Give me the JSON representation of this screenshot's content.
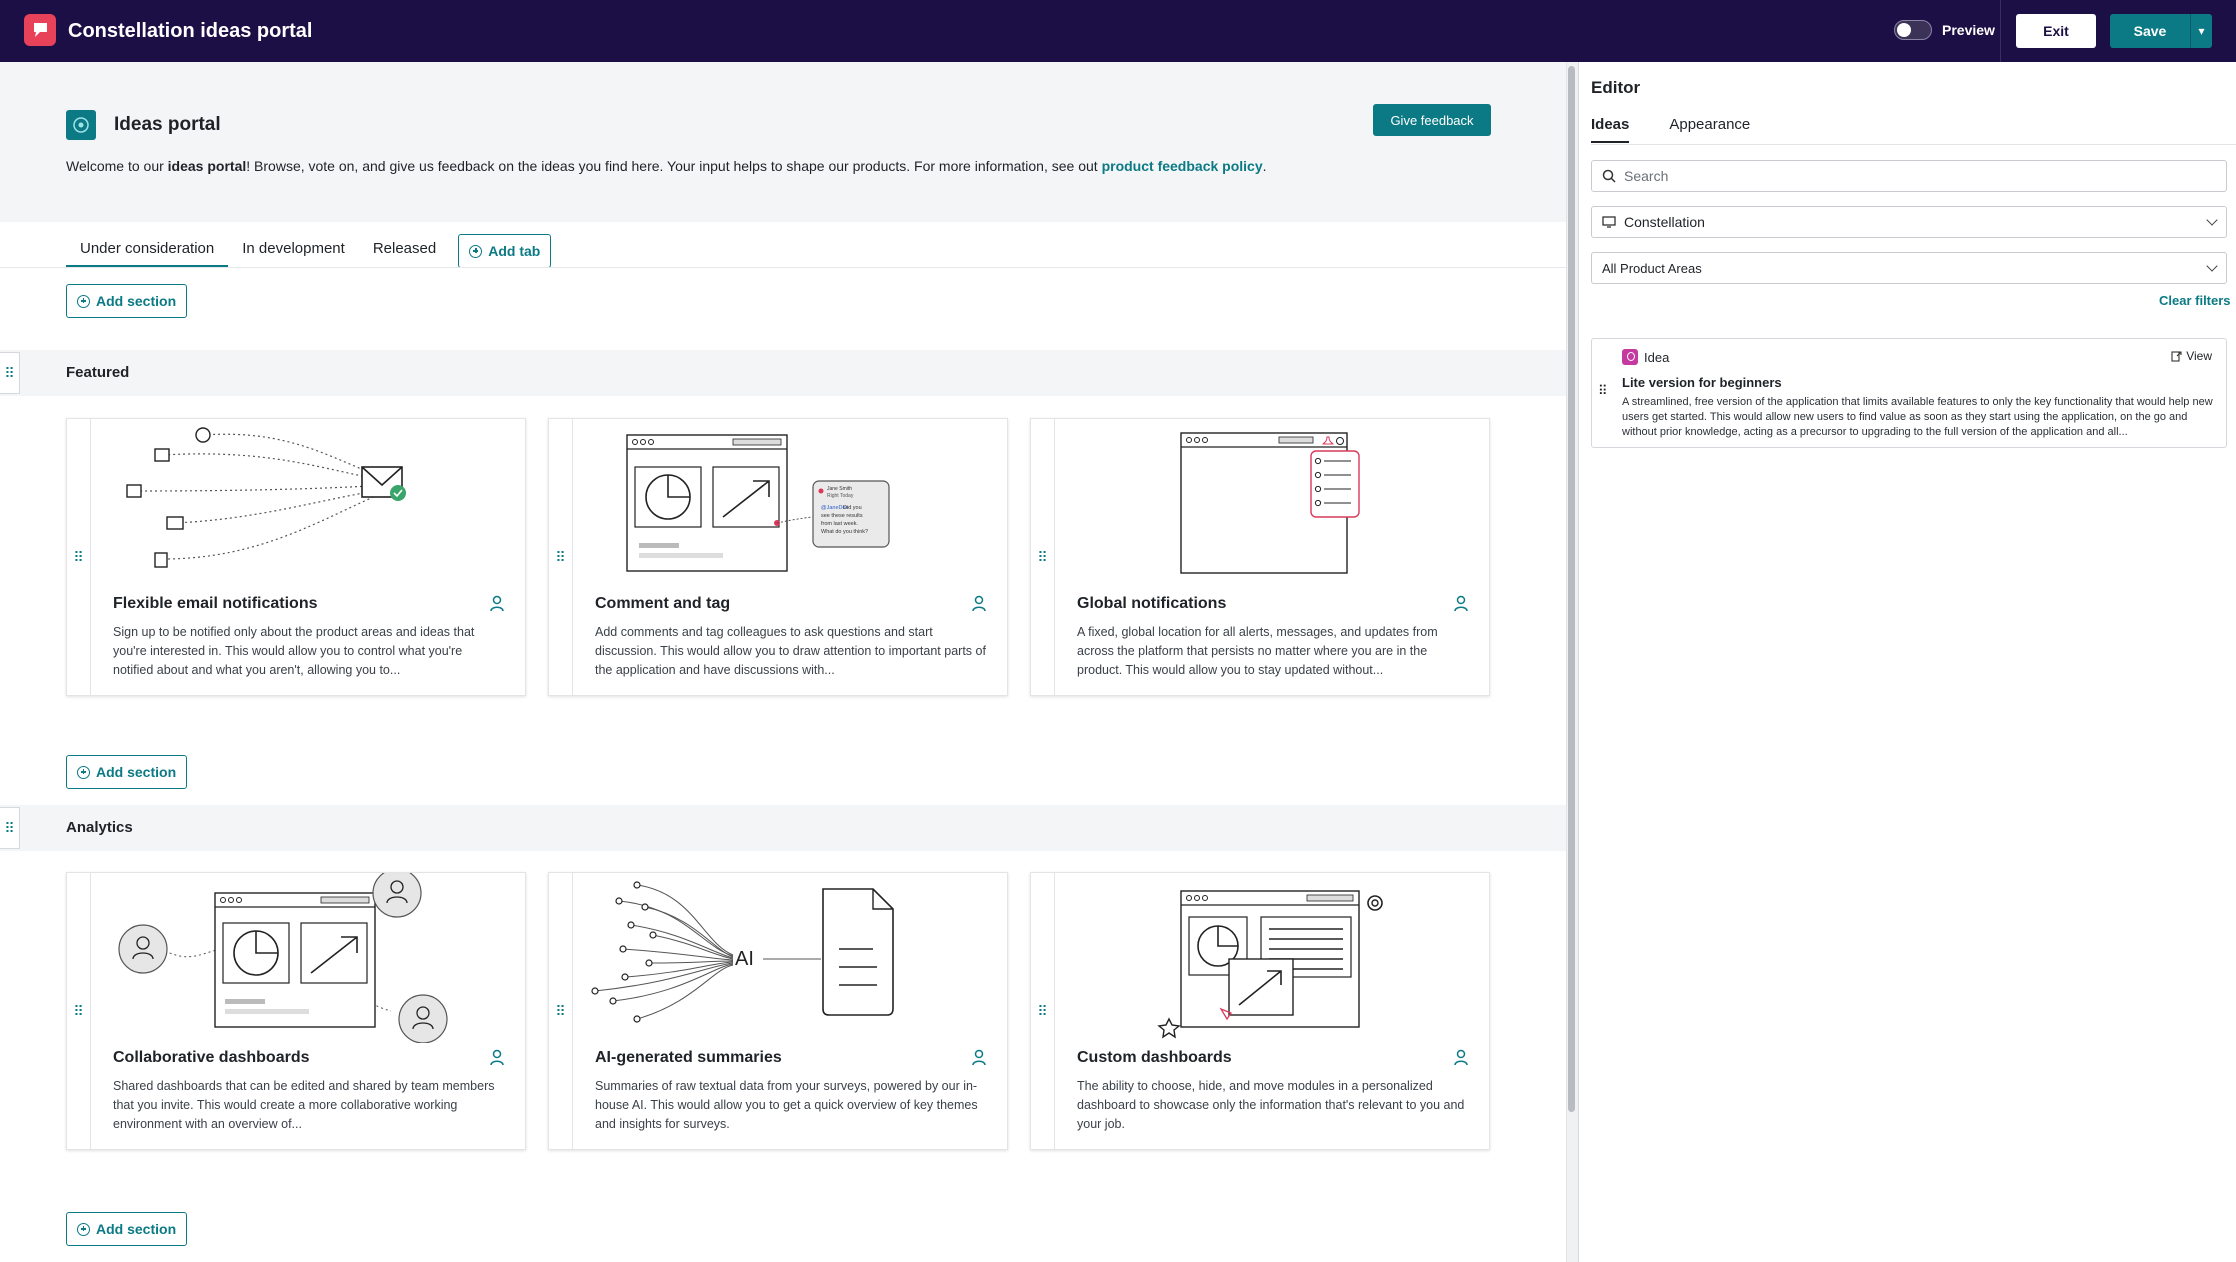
{
  "app": {
    "title": "Constellation ideas portal"
  },
  "header": {
    "preview_label": "Preview",
    "exit_label": "Exit",
    "save_label": "Save"
  },
  "portal": {
    "title": "Ideas portal",
    "feedback_label": "Give feedback",
    "welcome_prefix": "Welcome to our ",
    "welcome_bold": "ideas portal",
    "welcome_middle": "! Browse, vote on, and give us feedback on the ideas you find here. Your input helps to shape our products. For more information, see out ",
    "welcome_link": "product feedback policy",
    "welcome_suffix": "."
  },
  "tabs": [
    "Under consideration",
    "In development",
    "Released"
  ],
  "add_tab_label": "Add tab",
  "add_section_label": "Add section",
  "sections": [
    {
      "title": "Featured",
      "cards": [
        {
          "title": "Flexible email notifications",
          "desc": "Sign up to be notified only about the product areas and ideas that you're interested in. This would allow you to control what you're notified about and what you aren't, allowing you to..."
        },
        {
          "title": "Comment and tag",
          "desc": "Add comments and tag colleagues to ask questions and start discussion. This would allow you to draw attention to important parts of the application and have discussions with..."
        },
        {
          "title": "Global notifications",
          "desc": "A fixed, global location for all alerts, messages, and updates from across the platform that persists no matter where you are in the product. This would allow you to stay updated without..."
        }
      ]
    },
    {
      "title": "Analytics",
      "cards": [
        {
          "title": "Collaborative dashboards",
          "desc": "Shared dashboards that can be edited and shared by team members that you invite. This would create a more collaborative working environment with an overview of..."
        },
        {
          "title": "AI-generated summaries",
          "desc": "Summaries of raw textual data from your surveys, powered by our in-house AI. This would allow you to get a quick overview of key themes and insights for surveys."
        },
        {
          "title": "Custom dashboards",
          "desc": "The ability to choose, hide, and move modules in a personalized dashboard to showcase only the information that's relevant to you and your job."
        }
      ]
    }
  ],
  "art": {
    "comment_name": "Jane Smith",
    "comment_time": "Right Today",
    "comment_mention": "@JaneDoe",
    "comment_text_1": "Did you",
    "comment_text_2": "see these results",
    "comment_text_3": "from last week.",
    "comment_text_4": "What do you think?",
    "ai_label": "AI"
  },
  "editor": {
    "title": "Editor",
    "tabs": [
      "Ideas",
      "Appearance"
    ],
    "search_placeholder": "Search",
    "product_select": "Constellation",
    "area_select": "All Product Areas",
    "clear_filters": "Clear filters",
    "idea": {
      "type": "Idea",
      "view_label": "View",
      "title": "Lite version for beginners",
      "desc": "A streamlined, free version of the application that limits available features to only the key functionality that would help new users get started. This would allow new users to find value as soon as they start using the application, on the go and without prior knowledge, acting as a precursor to upgrading to the full version of the application and all..."
    }
  },
  "colors": {
    "topbar": "#1c0f46",
    "accent": "#0b7a85",
    "logo": "#e8425a",
    "idea_badge": "#c53aa0"
  }
}
